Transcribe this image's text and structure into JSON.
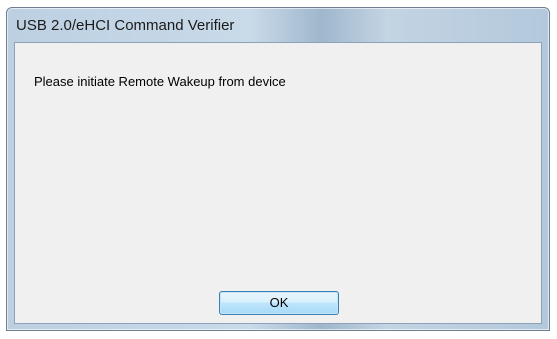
{
  "window": {
    "title": "USB 2.0/eHCI Command Verifier"
  },
  "dialog": {
    "message": "Please initiate Remote Wakeup from device",
    "ok_label": "OK"
  }
}
